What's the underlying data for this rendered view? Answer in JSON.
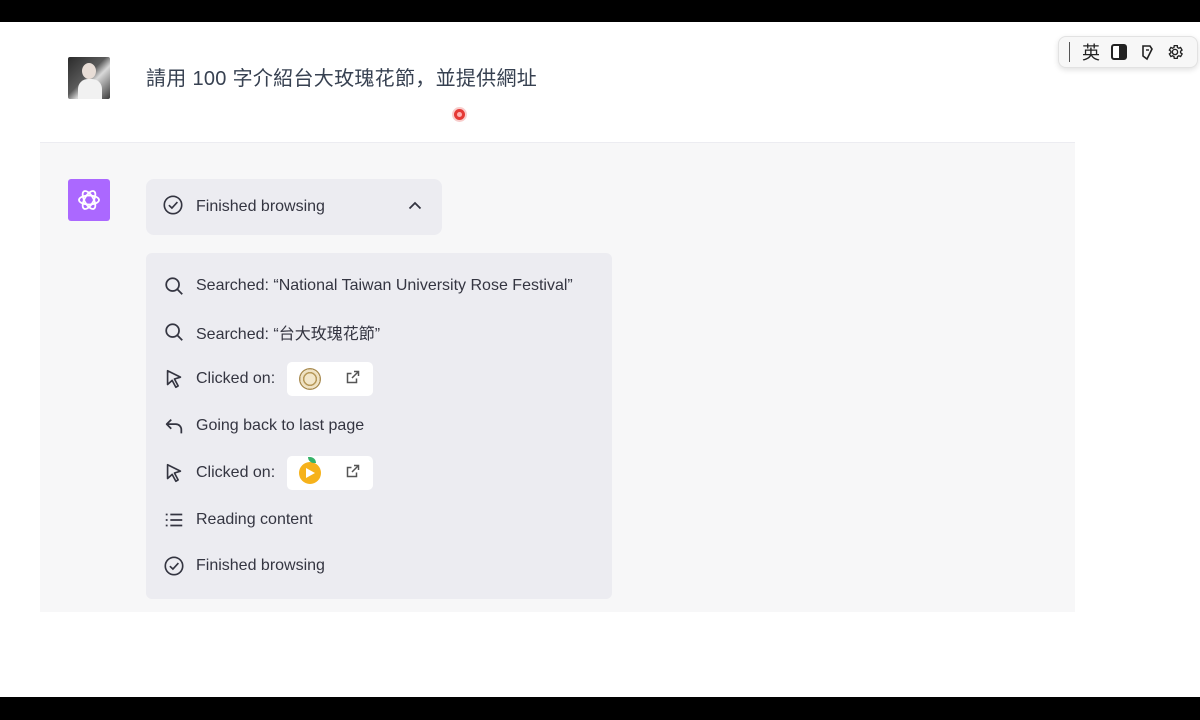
{
  "user": {
    "message": "請用 100 字介紹台大玫瑰花節，並提供網址"
  },
  "ime_toolbar": {
    "mode_label": "英"
  },
  "assistant": {
    "browse_toggle_label": "Finished browsing",
    "steps": [
      {
        "icon": "search-icon",
        "text": "Searched: “National Taiwan University Rose Festival”"
      },
      {
        "icon": "search-icon",
        "text": "Searched: “台大玫瑰花節”"
      },
      {
        "icon": "cursor-icon",
        "text": "Clicked on:",
        "chip_icon": "ntu-seal-icon"
      },
      {
        "icon": "back-arrow-icon",
        "text": "Going back to last page"
      },
      {
        "icon": "cursor-icon",
        "text": "Clicked on:",
        "chip_icon": "peach-play-icon"
      },
      {
        "icon": "list-icon",
        "text": "Reading content"
      },
      {
        "icon": "check-circle-icon",
        "text": "Finished browsing"
      }
    ]
  },
  "colors": {
    "assistant_avatar": "#ab68ff",
    "panel_bg": "#ececf1",
    "area_bg": "#f7f7f8",
    "cursor_dot": "#e53935"
  }
}
